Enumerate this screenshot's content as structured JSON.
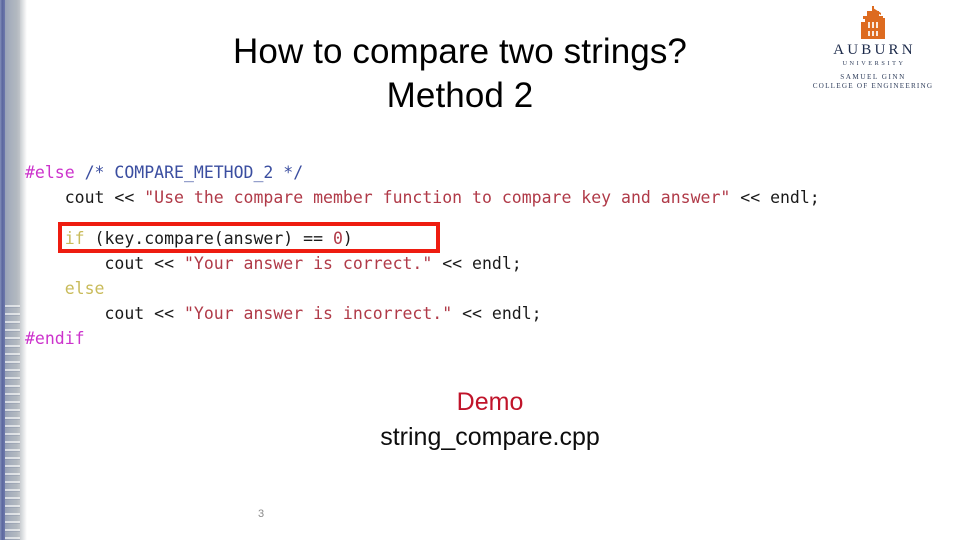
{
  "slide": {
    "page_number": "3",
    "background_color": "#ffffff"
  },
  "title": {
    "line1": "How to compare two strings?",
    "line2": "Method 2",
    "color": "#000000"
  },
  "logo": {
    "icon_name": "auburn-tower-icon",
    "icon_color": "#dd6b20",
    "name": "AUBURN",
    "subtitle": "UNIVERSITY",
    "college_line1": "SAMUEL GINN",
    "college_line2": "COLLEGE OF ENGINEERING",
    "text_color": "#1c2a4a"
  },
  "code": {
    "language": "cpp",
    "highlight_box_color": "#ee1c10",
    "colors": {
      "preprocessor": "#cc33cc",
      "comment": "#3b4ea0",
      "string": "#b03a48",
      "keyword": "#c9bb5a",
      "number": "#b03a48",
      "plain": "#1a1a1a"
    },
    "lines": [
      {
        "id": "line-else",
        "tokens": [
          {
            "t": "#else",
            "c": "pp"
          },
          {
            "t": " ",
            "c": "plain"
          },
          {
            "t": "/* COMPARE_METHOD_2 */",
            "c": "comment"
          }
        ]
      },
      {
        "id": "line-cout-use",
        "tokens": [
          {
            "t": "    cout << ",
            "c": "plain"
          },
          {
            "t": "\"Use the compare member function to compare key and answer\"",
            "c": "str"
          },
          {
            "t": " << endl;",
            "c": "plain"
          }
        ]
      },
      {
        "id": "line-blank",
        "blank": true,
        "tokens": []
      },
      {
        "id": "line-if",
        "tokens": [
          {
            "t": "    ",
            "c": "plain"
          },
          {
            "t": "if",
            "c": "kw"
          },
          {
            "t": " (key.compare(answer) == ",
            "c": "plain"
          },
          {
            "t": "0",
            "c": "num"
          },
          {
            "t": ")",
            "c": "plain"
          }
        ]
      },
      {
        "id": "line-cout-correct",
        "tokens": [
          {
            "t": "        cout << ",
            "c": "plain"
          },
          {
            "t": "\"Your answer is correct.\"",
            "c": "str"
          },
          {
            "t": " << endl;",
            "c": "plain"
          }
        ]
      },
      {
        "id": "line-else-kw",
        "tokens": [
          {
            "t": "    ",
            "c": "plain"
          },
          {
            "t": "else",
            "c": "kw"
          }
        ]
      },
      {
        "id": "line-cout-incorrect",
        "tokens": [
          {
            "t": "        cout << ",
            "c": "plain"
          },
          {
            "t": "\"Your answer is incorrect.\"",
            "c": "str"
          },
          {
            "t": " << endl;",
            "c": "plain"
          }
        ]
      },
      {
        "id": "line-endif",
        "tokens": [
          {
            "t": "#endif",
            "c": "pp"
          }
        ]
      }
    ]
  },
  "demo": {
    "label": "Demo",
    "label_color": "#c0142a",
    "filename": "string_compare.cpp",
    "filename_color": "#0d0d0d"
  }
}
